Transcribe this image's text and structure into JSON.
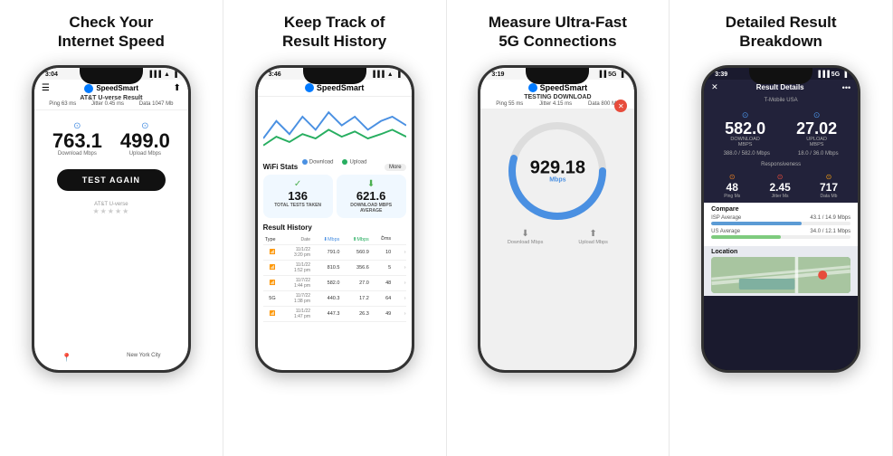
{
  "panels": [
    {
      "title": "Check Your\nInternet Speed",
      "phone": {
        "time": "3:04",
        "isp": "AT&T U-verse Result",
        "ping": "Ping 63 ms",
        "jitter": "Jitter 0.45 ms",
        "data": "Data 1047 Mb",
        "download": "763.1",
        "upload": "499.0",
        "dl_label": "Download Mbps",
        "ul_label": "Upload Mbps",
        "btn": "TEST AGAIN",
        "isp_bottom": "AT&T U-verse",
        "city": "New York City"
      }
    },
    {
      "title": "Keep Track of\nResult History",
      "phone": {
        "time": "3:46",
        "logo": "SpeedSmart",
        "wifi_stats_title": "WiFi Stats",
        "more": "More",
        "total_tests": "136",
        "total_tests_label": "TOTAL TESTS TAKEN",
        "avg_dl": "621.6",
        "avg_dl_label": "DOWNLOAD MBPS AVERAGE",
        "history_title": "Result History",
        "history_cols": [
          "Type",
          "Date",
          "Mbps",
          "Mbps",
          "ms"
        ],
        "history": [
          {
            "type": "wifi",
            "date": "11/1/22 3:20 pm",
            "dl": "791.0",
            "ul": "560.9",
            "ms": "10"
          },
          {
            "type": "wifi",
            "date": "11/1/22 1:52 pm",
            "dl": "810.5",
            "ul": "356.6",
            "ms": "5"
          },
          {
            "type": "wifi",
            "date": "11/7/22 1:44 pm",
            "dl": "582.0",
            "ul": "27.0",
            "ms": "48"
          },
          {
            "type": "5g",
            "date": "11/7/22 1:38 pm",
            "dl": "440.3",
            "ul": "17.2",
            "ms": "64"
          },
          {
            "type": "wifi",
            "date": "11/1/22 1:47 pm",
            "dl": "447.3",
            "ul": "26.3",
            "ms": "49"
          }
        ]
      }
    },
    {
      "title": "Measure Ultra-Fast\n5G Connections",
      "phone": {
        "time": "3:19",
        "logo": "SpeedSmart",
        "testing_label": "TESTING DOWNLOAD",
        "ping": "Ping 55 ms",
        "jitter": "Jitter 4.15 ms",
        "data": "Data 800 Mb",
        "speed": "929.18",
        "unit": "Mbps",
        "dl_icon": "⬇",
        "ul_icon": "⬆"
      }
    },
    {
      "title": "Detailed Result\nBreakdown",
      "phone": {
        "time": "3:39",
        "result_title": "Result Details",
        "isp": "T-Mobile USA",
        "download": "582.0",
        "upload": "27.02",
        "dl_label": "Download\nMbps",
        "ul_label": "Upload\nMbps",
        "dl_detail": "388.0 / 582.0 Mbps",
        "ul_detail": "18.0 / 36.0 Mbps",
        "responsiveness": "Responsiveness",
        "ping": "48",
        "ping_label": "Ping Ms",
        "jitter": "2.45",
        "jitter_label": "Jitter Ms",
        "data": "717",
        "data_label": "Data Mb",
        "compare_title": "Compare",
        "isp_avg": "43.1 / 14.9 Mbps",
        "us_avg": "34.0 / 12.1 Mbps",
        "isp_avg_label": "ISP Average",
        "us_avg_label": "US Average",
        "location_title": "Location"
      }
    }
  ],
  "colors": {
    "download": "#4a90e2",
    "upload": "#27ae60",
    "accent": "#007AFF",
    "dark": "#1a1a2e",
    "isp_bar": "#5b9bd5",
    "us_bar": "#7ecb7e"
  }
}
